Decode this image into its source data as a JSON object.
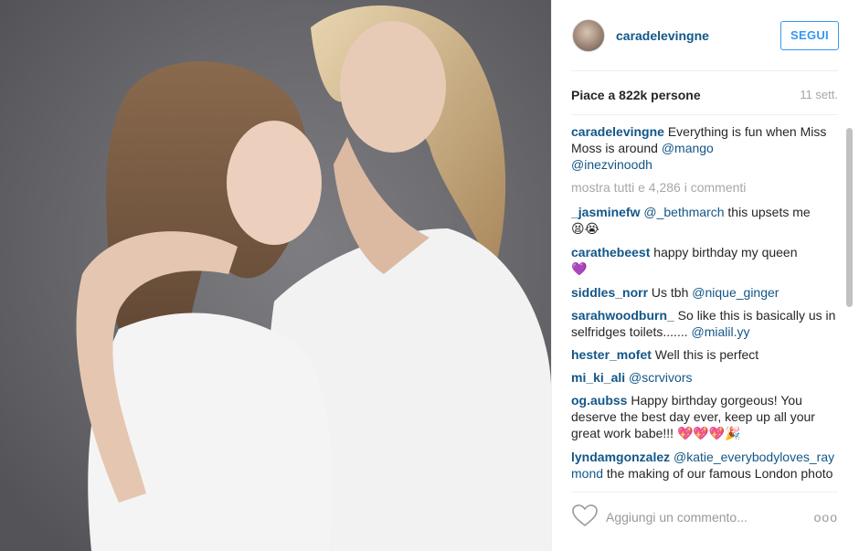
{
  "post": {
    "username": "caradelevingne",
    "follow_label": "SEGUI",
    "likes": "Piace a 822k persone",
    "time": "11 sett.",
    "caption": {
      "user": "caradelevingne",
      "text": " Everything is fun when Miss Moss is around ",
      "mention1": "@mango",
      "mention2": "@inezvinoodh"
    },
    "view_all": "mostra tutti e 4,286 i commenti",
    "comments": [
      {
        "user": "_jasminefw",
        "mention": "@_bethmarch",
        "text": " this upsets me ",
        "emoji": "😫😭"
      },
      {
        "user": "carathebeest",
        "text": " happy birthday my queen ",
        "emoji": "💜"
      },
      {
        "user": "siddles_norr",
        "text": " Us tbh ",
        "mention": "@nique_ginger"
      },
      {
        "user": "sarahwoodburn_",
        "text": " So like this is basically us in selfridges toilets....... ",
        "mention": "@mialil.yy"
      },
      {
        "user": "hester_mofet",
        "text": " Well this is perfect"
      },
      {
        "user": "mi_ki_ali",
        "mention": "@scrvivors"
      },
      {
        "user": "og.aubss",
        "text": " Happy birthday gorgeous! You deserve the best day ever, keep up all your great work babe!!! ",
        "emoji": "💖💖💖🎉"
      },
      {
        "user": "lyndamgonzalez",
        "mention": "@katie_everybodyloves_raymond",
        "text": " the making of our famous London photo"
      }
    ],
    "add_comment_placeholder": "Aggiungi un commento...",
    "more_options": "ooo"
  },
  "icons": {
    "like": "heart-outline-icon",
    "options": "ellipsis-icon"
  },
  "colors": {
    "username": "#125688",
    "follow": "#3897f0",
    "muted": "#a5a7aa"
  }
}
